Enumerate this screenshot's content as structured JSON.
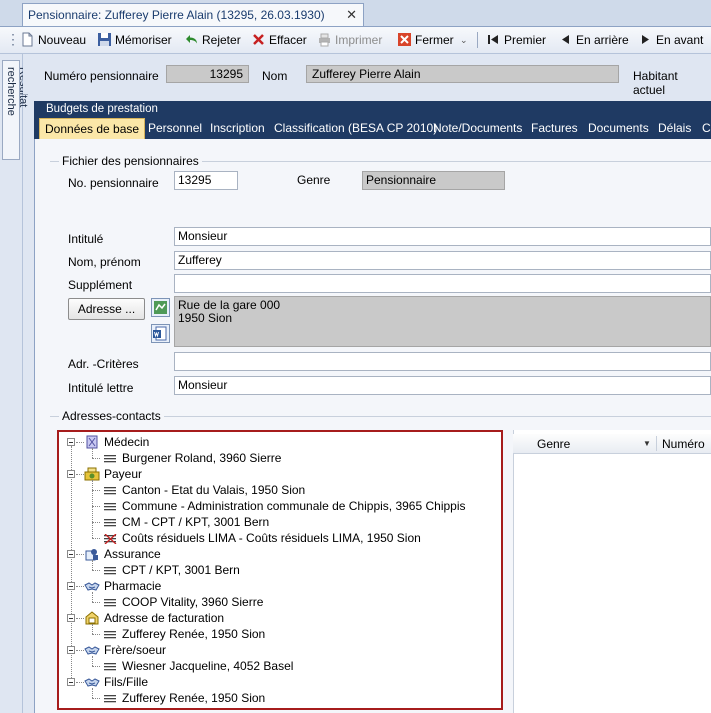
{
  "window": {
    "tab_title": "Pensionnaire: Zufferey Pierre Alain (13295, 26.03.1930)",
    "close": "✕"
  },
  "toolbar": {
    "nouveau": "Nouveau",
    "memoriser": "Mémoriser",
    "rejeter": "Rejeter",
    "effacer": "Effacer",
    "imprimer": "Imprimer",
    "fermer": "Fermer",
    "premier": "Premier",
    "en_arriere": "En arrière",
    "en_avant": "En avant"
  },
  "rail": {
    "label": "Résultat recherche"
  },
  "header": {
    "numero_label": "Numéro pensionnaire",
    "numero_value": "13295",
    "nom_label": "Nom",
    "nom_value": "Zufferey Pierre Alain",
    "habitant_label": "Habitant actuel"
  },
  "budget_bar": "Budgets de prestation",
  "tabs": [
    "Données de base",
    "Personnel",
    "Inscription",
    "Classification (BESA CP 2010)",
    "Note/Documents",
    "Factures",
    "Documents",
    "Délais",
    "Cl"
  ],
  "fichier": {
    "title": "Fichier des pensionnaires",
    "no_label": "No. pensionnaire",
    "no_value": "13295",
    "genre_label": "Genre",
    "genre_value": "Pensionnaire",
    "intitule_label": "Intitulé",
    "intitule_value": "Monsieur",
    "nom_label": "Nom, prénom",
    "nom_value": "Zufferey",
    "supplement_label": "Supplément",
    "supplement_value": "",
    "adresse_button": "Adresse ...",
    "adresse_line1": "Rue de la gare 000",
    "adresse_line2": "1950 Sion",
    "criteres_label": "Adr. -Critères",
    "criteres_value": "",
    "lettre_label": "Intitulé lettre",
    "lettre_value": "Monsieur"
  },
  "contacts": {
    "title": "Adresses-contacts",
    "grid_columns": [
      "Genre",
      "Numéro"
    ],
    "tree": [
      {
        "category": "Médecin",
        "icon": "doctor-icon",
        "items": [
          "Burgener Roland, 3960 Sierre"
        ]
      },
      {
        "category": "Payeur",
        "icon": "payer-icon",
        "items": [
          "Canton - Etat du Valais, 1950 Sion",
          "Commune - Administration communale de Chippis, 3965 Chippis",
          "CM - CPT / KPT, 3001 Bern",
          "Coûts résiduels LIMA - Coûts résiduels LIMA, 1950 Sion"
        ]
      },
      {
        "category": "Assurance",
        "icon": "insurance-icon",
        "items": [
          "CPT / KPT, 3001 Bern"
        ]
      },
      {
        "category": "Pharmacie",
        "icon": "handshake-icon",
        "items": [
          "COOP Vitality, 3960 Sierre"
        ]
      },
      {
        "category": "Adresse de facturation",
        "icon": "billing-address-icon",
        "items": [
          "Zufferey Renée, 1950 Sion"
        ]
      },
      {
        "category": "Frère/soeur",
        "icon": "handshake-icon",
        "items": [
          "Wiesner Jacqueline, 4052 Basel"
        ]
      },
      {
        "category": "Fils/Fille",
        "icon": "handshake-icon",
        "items": [
          "Zufferey Renée, 1950 Sion"
        ]
      }
    ]
  },
  "colors": {
    "accent": "#1f3a63",
    "active_tab": "#fbe7a8",
    "highlight_border": "#a61c1c"
  }
}
